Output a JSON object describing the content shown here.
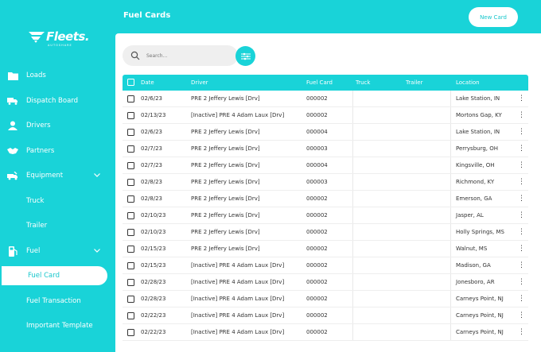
{
  "sidebar": {
    "logo_text": "Fleets.",
    "logo_sub": "AUTOSHARE",
    "items": [
      {
        "label": "Loads",
        "icon": "folder-icon"
      },
      {
        "label": "Dispatch Board",
        "icon": "truck-icon"
      },
      {
        "label": "Drivers",
        "icon": "user-icon"
      },
      {
        "label": "Partners",
        "icon": "handshake-icon"
      },
      {
        "label": "Equipment",
        "icon": "truck-tools-icon",
        "expand": "chevron-down-icon"
      },
      {
        "label": "Truck"
      },
      {
        "label": "Trailer"
      },
      {
        "label": "Fuel",
        "icon": "fuel-pump-icon",
        "expand": "chevron-down-icon"
      },
      {
        "label": "Fuel Card",
        "active": true
      },
      {
        "label": "Fuel Transaction"
      },
      {
        "label": "Important Template"
      }
    ]
  },
  "header": {
    "title": "Fuel Cards",
    "new_button": "New Card"
  },
  "search": {
    "placeholder": "Search..."
  },
  "table": {
    "columns": [
      "Date",
      "Driver",
      "Fuel Card",
      "Truck",
      "Trailer",
      "Location"
    ],
    "rows": [
      {
        "date": "02/6/23",
        "driver": "PRE 2 Jeffery Lewis [Drv]",
        "card": "000002",
        "truck": "",
        "trailer": "",
        "location": "Lake Station, IN"
      },
      {
        "date": "02/13/23",
        "driver": "[Inactive] PRE 4 Adam Laux [Drv]",
        "card": "000002",
        "truck": "",
        "trailer": "",
        "location": "Mortons Gap, KY"
      },
      {
        "date": "02/6/23",
        "driver": "PRE 2 Jeffery Lewis [Drv]",
        "card": "000004",
        "truck": "",
        "trailer": "",
        "location": "Lake Station, IN"
      },
      {
        "date": "02/7/23",
        "driver": "PRE 2 Jeffery Lewis [Drv]",
        "card": "000003",
        "truck": "",
        "trailer": "",
        "location": "Perrysburg, OH"
      },
      {
        "date": "02/7/23",
        "driver": "PRE 2 Jeffery Lewis [Drv]",
        "card": "000004",
        "truck": "",
        "trailer": "",
        "location": "Kingsville, OH"
      },
      {
        "date": "02/8/23",
        "driver": "PRE 2 Jeffery Lewis [Drv]",
        "card": "000003",
        "truck": "",
        "trailer": "",
        "location": "Richmond, KY"
      },
      {
        "date": "02/8/23",
        "driver": "PRE 2 Jeffery Lewis [Drv]",
        "card": "000002",
        "truck": "",
        "trailer": "",
        "location": "Emerson, GA"
      },
      {
        "date": "02/10/23",
        "driver": "PRE 2 Jeffery Lewis [Drv]",
        "card": "000002",
        "truck": "",
        "trailer": "",
        "location": "Jasper, AL"
      },
      {
        "date": "02/10/23",
        "driver": "PRE 2 Jeffery Lewis [Drv]",
        "card": "000002",
        "truck": "",
        "trailer": "",
        "location": "Holly Springs, MS"
      },
      {
        "date": "02/15/23",
        "driver": "PRE 2 Jeffery Lewis [Drv]",
        "card": "000002",
        "truck": "",
        "trailer": "",
        "location": "Walnut, MS"
      },
      {
        "date": "02/15/23",
        "driver": "[Inactive] PRE 4 Adam Laux [Drv]",
        "card": "000002",
        "truck": "",
        "trailer": "",
        "location": "Madison, GA"
      },
      {
        "date": "02/28/23",
        "driver": "[Inactive] PRE 4 Adam Laux [Drv]",
        "card": "000002",
        "truck": "",
        "trailer": "",
        "location": "Jonesboro, AR"
      },
      {
        "date": "02/28/23",
        "driver": "[Inactive] PRE 4 Adam Laux [Drv]",
        "card": "000002",
        "truck": "",
        "trailer": "",
        "location": "Carneys Point, NJ"
      },
      {
        "date": "02/22/23",
        "driver": "[Inactive] PRE 4 Adam Laux [Drv]",
        "card": "000002",
        "truck": "",
        "trailer": "",
        "location": "Carneys Point, NJ"
      },
      {
        "date": "02/22/23",
        "driver": "[Inactive] PRE 4 Adam Laux [Drv]",
        "card": "000002",
        "truck": "",
        "trailer": "",
        "location": "Carneys Point, NJ"
      }
    ],
    "row_menu_icon": "more-vertical-icon"
  },
  "colors": {
    "accent": "#19d3d8",
    "panel": "#ffffff",
    "search_bg": "#efefef"
  }
}
